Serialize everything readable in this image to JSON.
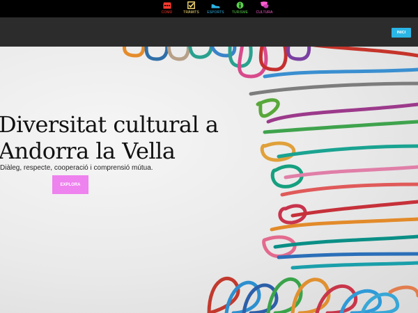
{
  "nav": {
    "items": [
      {
        "label": "COMÚ",
        "color": "#ff3b2f",
        "icon": "building-icon"
      },
      {
        "label": "TRÀMITS",
        "color": "#ffe27a",
        "icon": "checkbox-icon"
      },
      {
        "label": "ESPORTS",
        "color": "#2bb5e6",
        "icon": "sneaker-icon"
      },
      {
        "label": "TURISME",
        "color": "#58d04a",
        "icon": "info-icon"
      },
      {
        "label": "CULTURA",
        "color": "#ff5fd2",
        "icon": "theater-icon"
      }
    ]
  },
  "header": {
    "inici_label": "INICI"
  },
  "hero": {
    "title_line1": "Diversitat cultural a",
    "title_line2": "Andorra la Vella",
    "subtitle": "Diàleg, respecte, cooperació i comprensió mútua.",
    "cta_label": "EXPLORA"
  }
}
